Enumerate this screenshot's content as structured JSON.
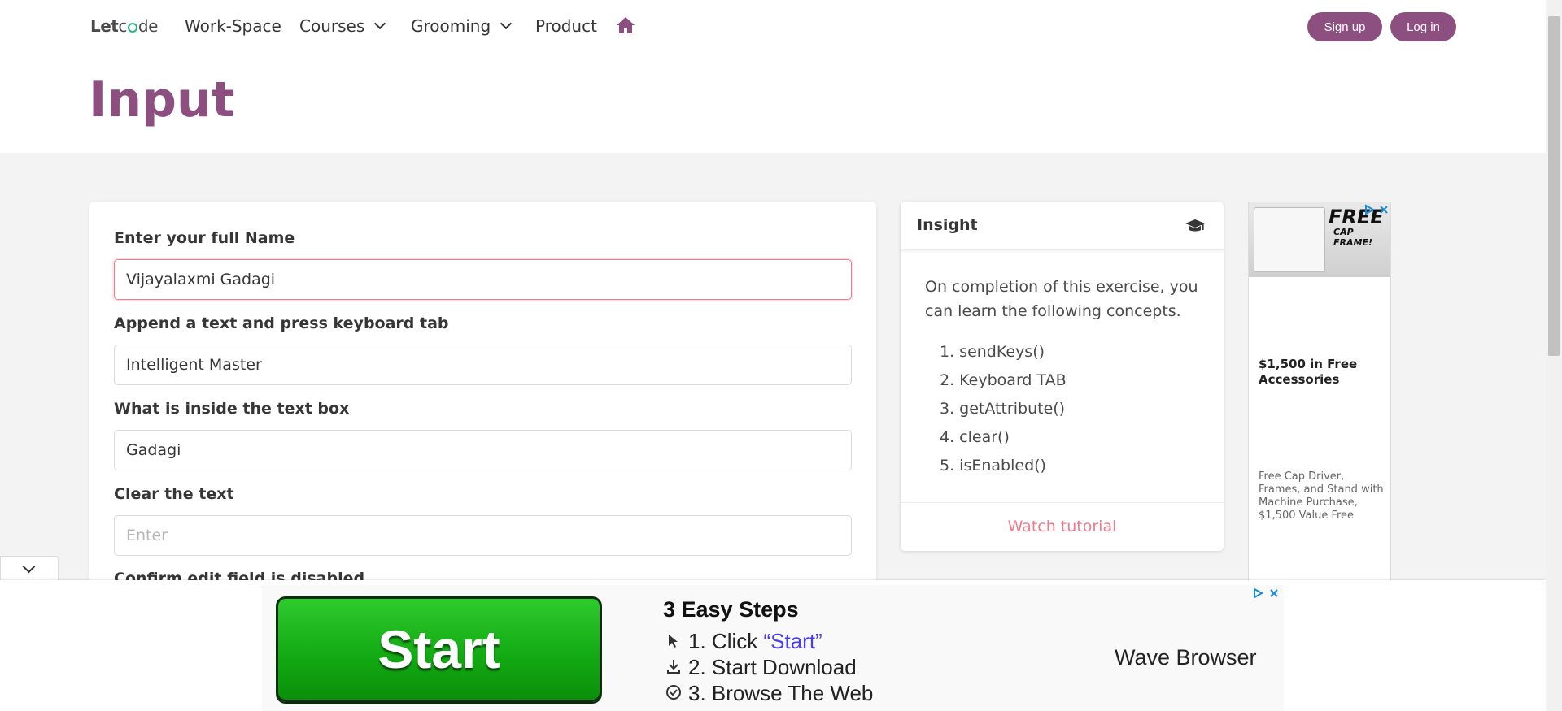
{
  "nav": {
    "logo_prefix": "Let",
    "logo_suffix": "de",
    "items": [
      {
        "label": "Work-Space"
      },
      {
        "label": "Courses"
      },
      {
        "label": "Grooming"
      },
      {
        "label": "Product"
      }
    ],
    "signup_label": "Sign up",
    "login_label": "Log in",
    "accent": "#8c4f7f"
  },
  "page": {
    "title": "Input"
  },
  "form": {
    "fields": [
      {
        "label": "Enter your full Name",
        "value": "Vijayalaxmi Gadagi",
        "placeholder": ""
      },
      {
        "label": "Append a text and press keyboard tab",
        "value": "Intelligent Master",
        "placeholder": ""
      },
      {
        "label": "What is inside the text box",
        "value": "Gadagi",
        "placeholder": ""
      },
      {
        "label": "Clear the text",
        "value": "",
        "placeholder": "Enter"
      },
      {
        "label": "Confirm edit field is disabled"
      }
    ]
  },
  "insight": {
    "title": "Insight",
    "intro": "On completion of this exercise, you can learn the following concepts.",
    "concepts": [
      "sendKeys()",
      "Keyboard TAB",
      "getAttribute()",
      "clear()",
      "isEnabled()"
    ],
    "watch_label": "Watch tutorial"
  },
  "side_ad": {
    "image_text": "FREE",
    "image_subtext": "CAP FRAME!",
    "title": "$1,500 in Free Accessories",
    "description": "Free Cap Driver, Frames, and Stand with Machine Purchase, $1,500 Value Free"
  },
  "bottom_ad": {
    "button_label": "Start",
    "steps_title": "3 Easy Steps",
    "steps": [
      {
        "num": "1.",
        "prefix": "Click ",
        "highlight": "“Start”"
      },
      {
        "num": "2.",
        "prefix": "Start Download",
        "highlight": ""
      },
      {
        "num": "3.",
        "prefix": "Browse The Web",
        "highlight": ""
      }
    ],
    "brand": "Wave Browser"
  }
}
